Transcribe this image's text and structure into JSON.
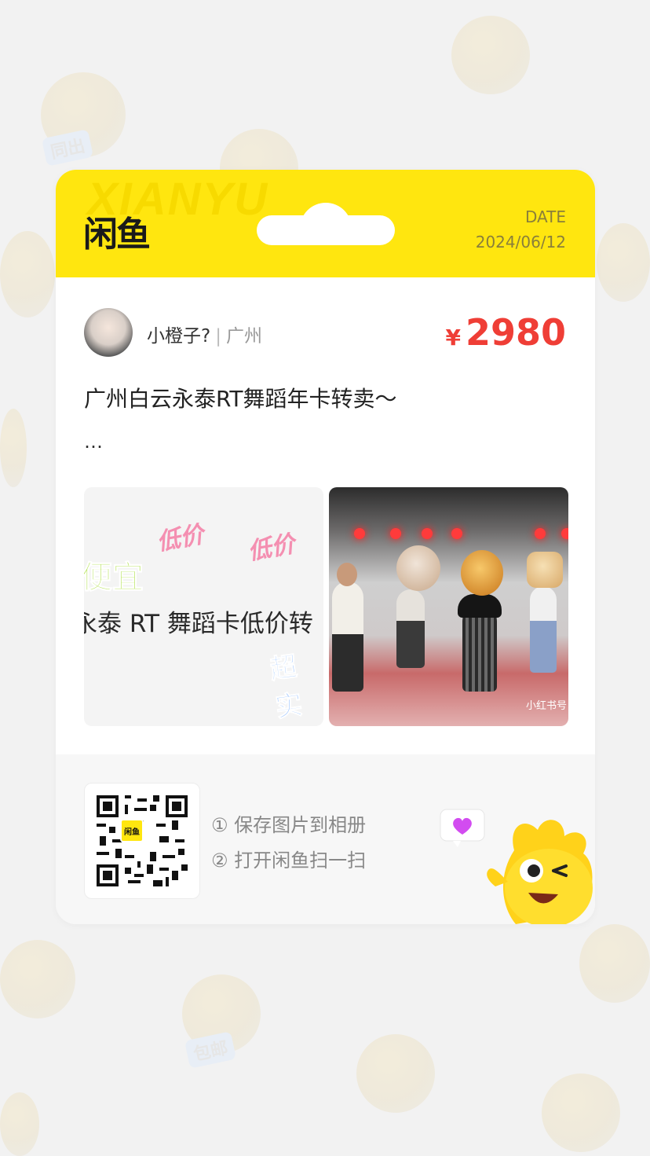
{
  "background": {
    "tags": [
      "同出",
      "包邮"
    ]
  },
  "header": {
    "watermark": "XIANYU",
    "logo": "闲鱼",
    "date_label": "DATE",
    "date_value": "2024/06/12"
  },
  "seller": {
    "name": "小橙子?",
    "separator": "|",
    "city": "广州"
  },
  "price": {
    "symbol": "¥",
    "amount": "2980",
    "color": "#ef3e36"
  },
  "listing": {
    "title": "广州白云永泰RT舞蹈年卡转卖～",
    "ellipsis": "…"
  },
  "images": {
    "first": {
      "deco_low1": "低价",
      "deco_low2": "低价",
      "deco_cheap": "便宜",
      "main_text": "永泰 RT 舞蹈卡低价转",
      "deco_sale": "超实"
    },
    "second": {
      "watermark": "小红书号"
    }
  },
  "footer": {
    "qr_badge": "闲鱼",
    "step1": "① 保存图片到相册",
    "step2": "② 打开闲鱼扫一扫"
  },
  "colors": {
    "brand_yellow": "#ffe60f",
    "background": "#f2f2f2"
  }
}
